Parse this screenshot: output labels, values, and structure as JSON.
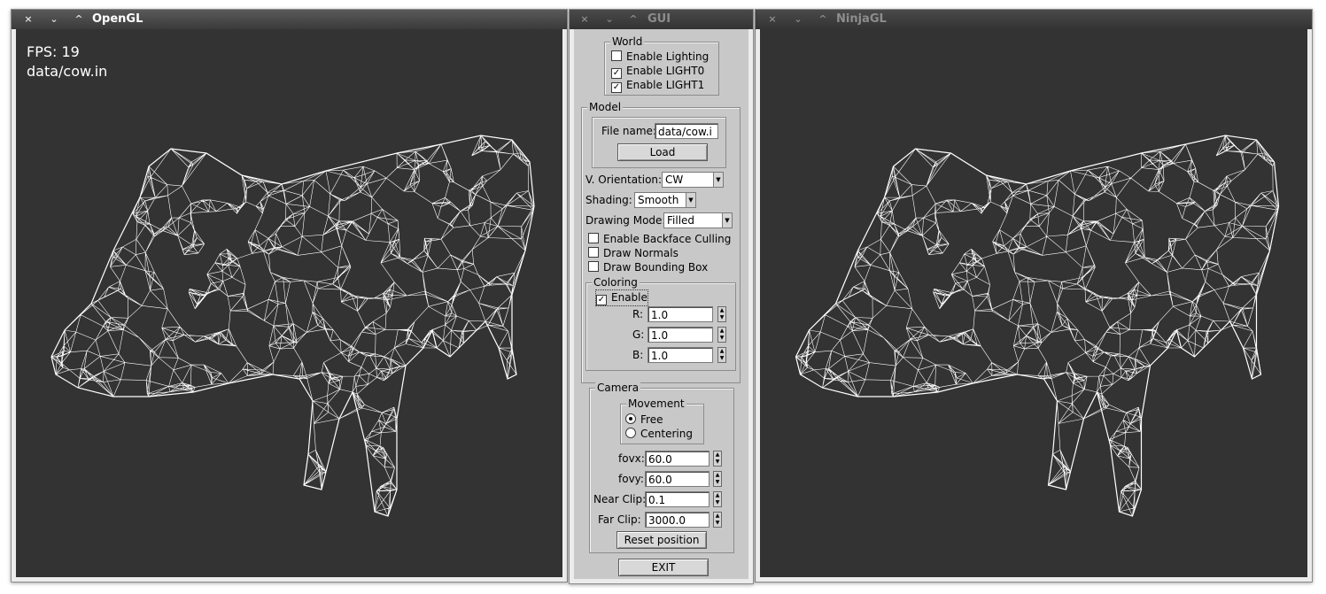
{
  "left_window": {
    "title": "OpenGL",
    "fps": "FPS: 19",
    "file": "data/cow.in"
  },
  "right_window": {
    "title": "NinjaGL"
  },
  "titlebar_buttons": {
    "close": "×",
    "minimize": "⌄",
    "maximize": "^"
  },
  "gui": {
    "title": "GUI",
    "world": {
      "title": "World",
      "enable_lighting": "Enable Lighting",
      "enable_light0": "Enable LIGHT0",
      "enable_light1": "Enable LIGHT1",
      "check_mark": "✓"
    },
    "model": {
      "title": "Model",
      "file_label": "File name:",
      "file_value": "data/cow.i",
      "load_button": "Load",
      "orientation_label": "V. Orientation:",
      "orientation_value": "CW",
      "shading_label": "Shading:",
      "shading_value": "Smooth",
      "drawing_mode_label": "Drawing Mode:",
      "drawing_mode_value": "Filled",
      "backface_culling": "Enable Backface Culling",
      "draw_normals": "Draw Normals",
      "draw_bounding_box": "Draw Bounding Box",
      "coloring": {
        "title": "Coloring",
        "enable": "Enable",
        "r_label": "R:",
        "r_value": "1.0",
        "g_label": "G:",
        "g_value": "1.0",
        "b_label": "B:",
        "b_value": "1.0"
      }
    },
    "camera": {
      "title": "Camera",
      "movement": {
        "title": "Movement",
        "free": "Free",
        "centering": "Centering"
      },
      "fovx_label": "fovx:",
      "fovx_value": "60.0",
      "fovy_label": "fovy:",
      "fovy_value": "60.0",
      "near_label": "Near Clip:",
      "near_value": "0.1",
      "far_label": "Far Clip:",
      "far_value": "3000.0",
      "reset_button": "Reset position"
    },
    "exit_button": "EXIT"
  },
  "colors": {
    "viewport_bg": "#333333",
    "wireframe": "#ffffff",
    "panel_bg": "#c8c8c8"
  }
}
